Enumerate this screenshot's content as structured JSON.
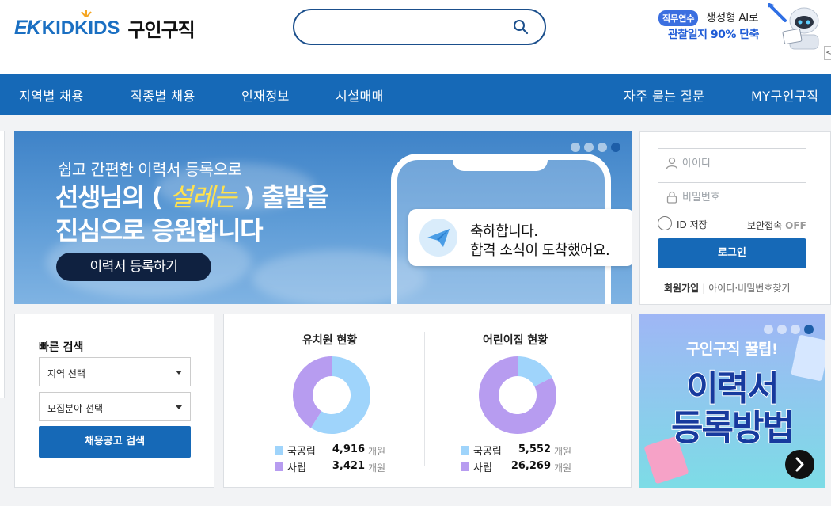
{
  "header": {
    "logo_ek": "EK",
    "logo_kidkids": "KIDKIDS",
    "logo_service": "구인구직",
    "search": {
      "placeholder": "",
      "value": ""
    },
    "ad": {
      "badge": "직무연수",
      "line1": "생성형 AI로",
      "line2": "관찰일지 90% 단축"
    },
    "side_tab": "<"
  },
  "nav": {
    "items": [
      {
        "label": "지역별 채용"
      },
      {
        "label": "직종별 채용"
      },
      {
        "label": "인재정보"
      },
      {
        "label": "시설매매"
      },
      {
        "label": "자주 묻는 질문"
      },
      {
        "label": "MY구인구직"
      }
    ]
  },
  "hero": {
    "subtitle": "쉽고 간편한 이력서 등록으로",
    "headline_1a": "선생님의 (",
    "headline_1b": "설레는",
    "headline_1c": ") 출발을",
    "headline_2": "진심으로 응원합니다",
    "cta": "이력서 등록하기",
    "bubble_line1": "축하합니다.",
    "bubble_line2": "합격 소식이 도착했어요.",
    "slides": 4,
    "active_slide": 4
  },
  "login": {
    "id_placeholder": "아이디",
    "pw_placeholder": "비밀번호",
    "save_id": "ID 저장",
    "secure": "보안접속",
    "secure_state": "OFF",
    "button": "로그인",
    "signup": "회원가입",
    "sep": "|",
    "find": "아이디·비밀번호찾기"
  },
  "quick_search": {
    "title": "빠른 검색",
    "region": "지역 선택",
    "field": "모집분야 선택",
    "button": "채용공고 검색"
  },
  "stats": {
    "kindergarten": {
      "title": "유치원 현황",
      "rows": [
        {
          "label": "국공립",
          "value": "4,916",
          "unit": "개원",
          "color": "#9fd4fb"
        },
        {
          "label": "사립",
          "value": "3,421",
          "unit": "개원",
          "color": "#b79cf0"
        }
      ]
    },
    "daycare": {
      "title": "어린이집 현황",
      "rows": [
        {
          "label": "국공립",
          "value": "5,552",
          "unit": "개원",
          "color": "#9fd4fb"
        },
        {
          "label": "사립",
          "value": "26,269",
          "unit": "개원",
          "color": "#b79cf0"
        }
      ]
    }
  },
  "tip_banner": {
    "line1": "구인구직 꿀팁!",
    "line2": "이력서",
    "line3": "등록방법",
    "slides": 4,
    "active_slide": 4
  }
}
